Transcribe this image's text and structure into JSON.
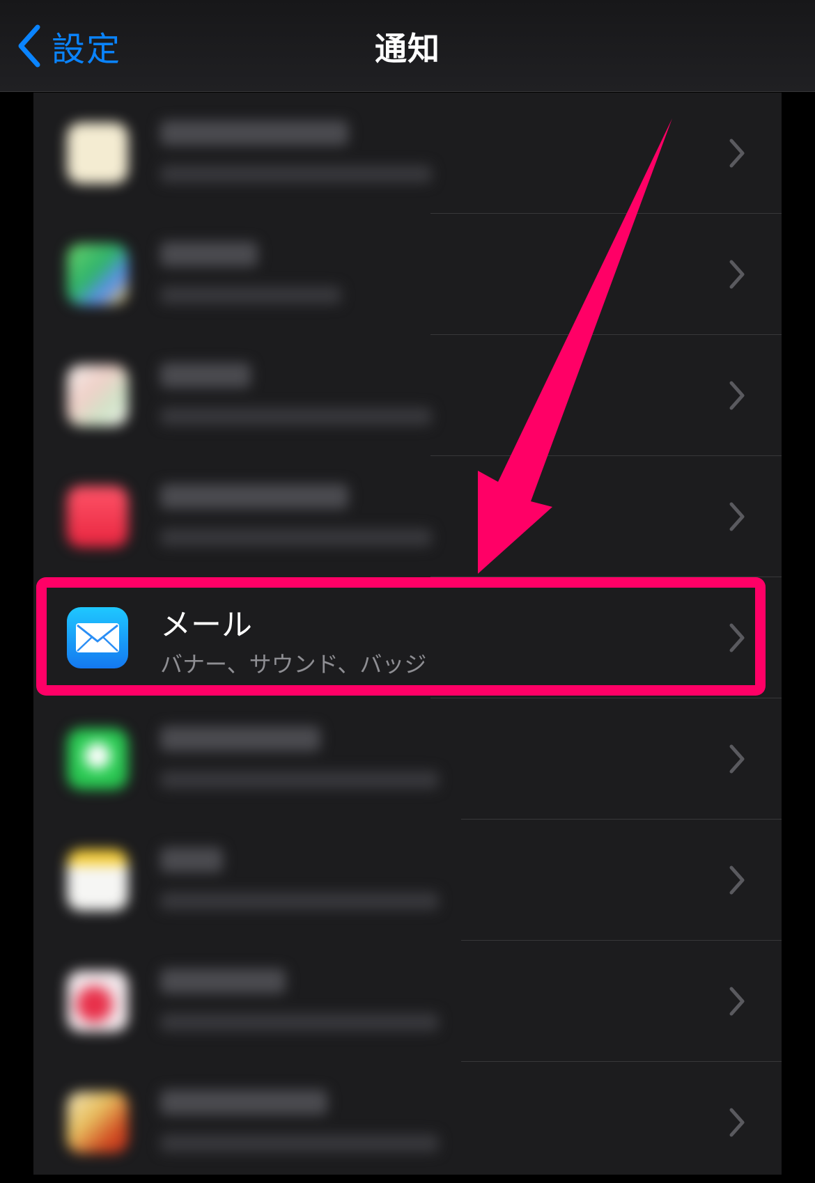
{
  "nav": {
    "back_label": "設定",
    "title": "通知"
  },
  "colors": {
    "accent": "#0a84ff",
    "highlight": "#ff0066",
    "background": "#1c1c1e"
  },
  "rows": [
    {
      "title": "",
      "subtitle": "",
      "icon": "blurred-app-icon",
      "blurred": true
    },
    {
      "title": "",
      "subtitle": "",
      "icon": "maps-icon",
      "blurred": true
    },
    {
      "title": "",
      "subtitle": "",
      "icon": "blurred-app-icon",
      "blurred": true
    },
    {
      "title": "",
      "subtitle": "",
      "icon": "music-icon",
      "blurred": true
    },
    {
      "title": "メール",
      "subtitle": "バナー、サウンド、バッジ",
      "icon": "mail-icon",
      "blurred": false
    },
    {
      "title": "",
      "subtitle": "",
      "icon": "messages-icon",
      "blurred": true
    },
    {
      "title": "",
      "subtitle": "",
      "icon": "notes-icon",
      "blurred": true
    },
    {
      "title": "",
      "subtitle": "",
      "icon": "blurred-app-icon",
      "blurred": true
    },
    {
      "title": "",
      "subtitle": "",
      "icon": "blurred-app-icon",
      "blurred": true
    }
  ]
}
